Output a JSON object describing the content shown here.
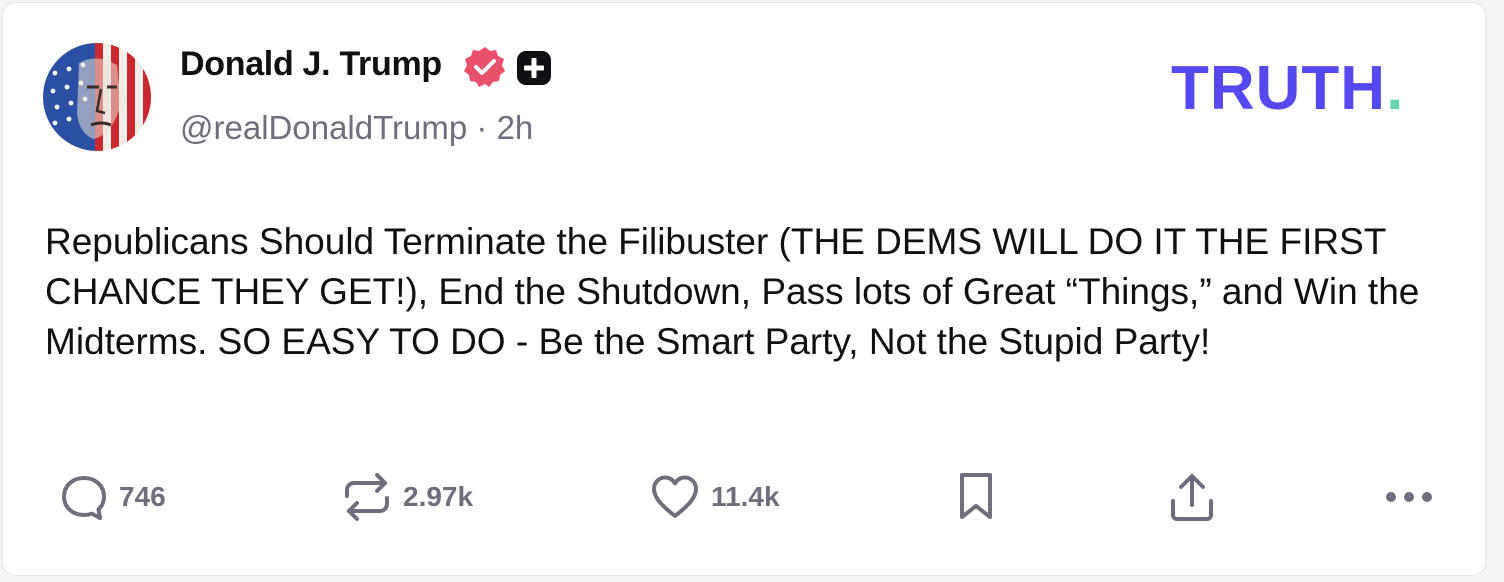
{
  "post": {
    "author_name": "Donald J. Trump",
    "handle": "@realDonaldTrump",
    "separator": "·",
    "time_ago": "2h",
    "text": "Republicans Should Terminate the Filibuster (THE DEMS WILL DO IT THE FIRST CHANCE THEY GET!), End the Shutdown, Pass lots of Great “Things,” and Win the Midterms. SO EASY TO DO - Be the Smart Party, Not the Stupid Party!"
  },
  "brand": {
    "logo_text": "TRUTH",
    "logo_dot": ".",
    "color": "#5448ee",
    "dot_color": "#65d6ad"
  },
  "badges": {
    "verified_icon": "verified-badge-icon",
    "verified_color": "#e8506b",
    "plus_icon": "plus-square-icon"
  },
  "actions": {
    "reply_count": "746",
    "retruth_count": "2.97k",
    "like_count": "11.4k",
    "icons": [
      "reply-icon",
      "retruth-icon",
      "like-icon",
      "bookmark-icon",
      "share-icon",
      "more-icon"
    ]
  },
  "colors": {
    "text": "#0f0f14",
    "muted": "#6e6e7c",
    "icon": "#6e6e7c"
  }
}
